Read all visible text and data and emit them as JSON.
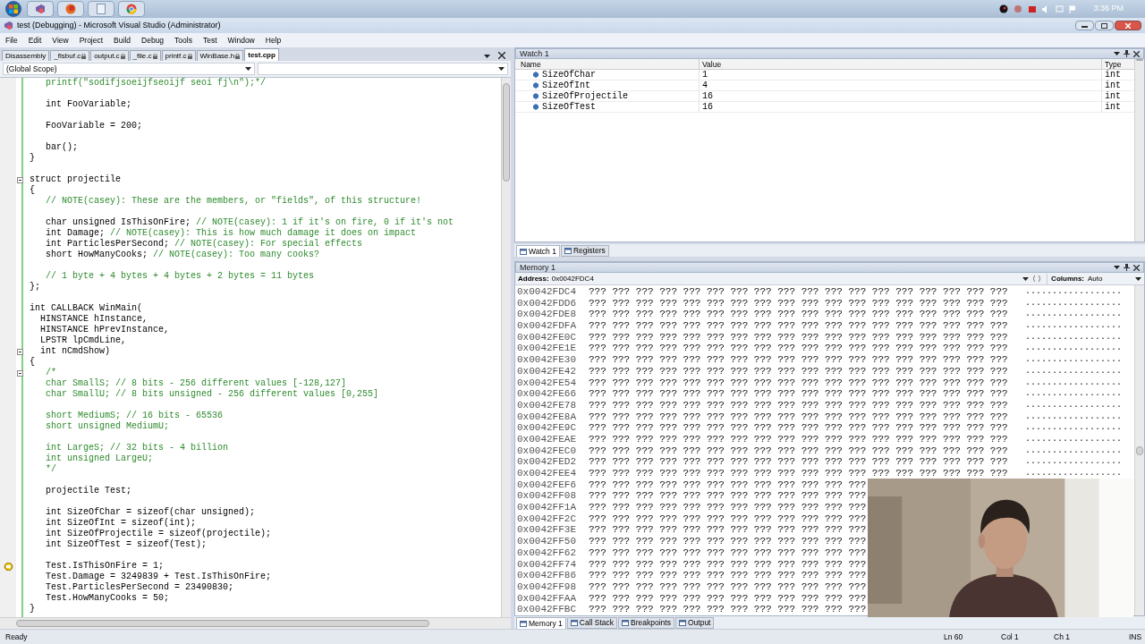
{
  "taskbar": {
    "clock": "3:36 PM"
  },
  "window": {
    "title": "test (Debugging) - Microsoft Visual Studio (Administrator)"
  },
  "menu": [
    "File",
    "Edit",
    "View",
    "Project",
    "Build",
    "Debug",
    "Tools",
    "Test",
    "Window",
    "Help"
  ],
  "editor": {
    "tabs": [
      {
        "label": "Disassembly",
        "selected": false
      },
      {
        "label": "_flsbuf.c",
        "selected": false
      },
      {
        "label": "output.c",
        "selected": false
      },
      {
        "label": "_file.c",
        "selected": false
      },
      {
        "label": "printf.c",
        "selected": false
      },
      {
        "label": "WinBase.h",
        "selected": false
      },
      {
        "label": "test.cpp",
        "selected": true
      }
    ],
    "scope": "(Global Scope)",
    "lines": [
      {
        "kind": "text",
        "comment": "   printf(\"sodifjsoeijfseoijf seoi fj\\n\");*/",
        "fold": false,
        "current": false
      },
      {
        "kind": "blank",
        "fold": false,
        "current": false
      },
      {
        "kind": "text",
        "code": "   int FooVariable;",
        "fold": false,
        "current": false
      },
      {
        "kind": "blank",
        "fold": false,
        "current": false
      },
      {
        "kind": "text",
        "code": "   FooVariable = 200;",
        "fold": false,
        "current": false
      },
      {
        "kind": "blank",
        "fold": false,
        "current": false
      },
      {
        "kind": "text",
        "code": "   bar();",
        "fold": false,
        "current": false
      },
      {
        "kind": "text",
        "code": "}",
        "fold": false,
        "current": false
      },
      {
        "kind": "blank",
        "fold": false,
        "current": false
      },
      {
        "kind": "text",
        "code": "struct projectile",
        "fold": true,
        "current": false
      },
      {
        "kind": "text",
        "code": "{",
        "fold": false,
        "current": false
      },
      {
        "kind": "text",
        "comment": "   // NOTE(casey): These are the members, or \"fields\", of this structure!",
        "fold": false,
        "current": false
      },
      {
        "kind": "blank",
        "fold": false,
        "current": false
      },
      {
        "kind": "text",
        "code": "   char unsigned IsThisOnFire; ",
        "comment": "// NOTE(casey): 1 if it's on fire, 0 if it's not",
        "fold": false,
        "current": false
      },
      {
        "kind": "text",
        "code": "   int Damage; ",
        "comment": "// NOTE(casey): This is how much damage it does on impact",
        "fold": false,
        "current": false
      },
      {
        "kind": "text",
        "code": "   int ParticlesPerSecond; ",
        "comment": "// NOTE(casey): For special effects",
        "fold": false,
        "current": false
      },
      {
        "kind": "text",
        "code": "   short HowManyCooks; ",
        "comment": "// NOTE(casey): Too many cooks?",
        "fold": false,
        "current": false
      },
      {
        "kind": "blank",
        "fold": false,
        "current": false
      },
      {
        "kind": "text",
        "comment": "   // 1 byte + 4 bytes + 4 bytes + 2 bytes = 11 bytes",
        "fold": false,
        "current": false
      },
      {
        "kind": "text",
        "code": "};",
        "fold": false,
        "current": false
      },
      {
        "kind": "blank",
        "fold": false,
        "current": false
      },
      {
        "kind": "text",
        "code": "int CALLBACK WinMain(",
        "fold": false,
        "current": false
      },
      {
        "kind": "text",
        "code": "  HINSTANCE hInstance,",
        "fold": false,
        "current": false
      },
      {
        "kind": "text",
        "code": "  HINSTANCE hPrevInstance,",
        "fold": false,
        "current": false
      },
      {
        "kind": "text",
        "code": "  LPSTR lpCmdLine,",
        "fold": false,
        "current": false
      },
      {
        "kind": "text",
        "code": "  int nCmdShow)",
        "fold": true,
        "current": false
      },
      {
        "kind": "text",
        "code": "{",
        "fold": false,
        "current": false
      },
      {
        "kind": "text",
        "comment": "   /*",
        "fold": true,
        "current": false
      },
      {
        "kind": "text",
        "comment": "   char SmallS; // 8 bits - 256 different values [-128,127]",
        "fold": false,
        "current": false
      },
      {
        "kind": "text",
        "comment": "   char SmallU; // 8 bits unsigned - 256 different values [0,255]",
        "fold": false,
        "current": false
      },
      {
        "kind": "blank",
        "fold": false,
        "current": false
      },
      {
        "kind": "text",
        "comment": "   short MediumS; // 16 bits - 65536",
        "fold": false,
        "current": false
      },
      {
        "kind": "text",
        "comment": "   short unsigned MediumU;",
        "fold": false,
        "current": false
      },
      {
        "kind": "blank",
        "fold": false,
        "current": false
      },
      {
        "kind": "text",
        "comment": "   int LargeS; // 32 bits - 4 billion",
        "fold": false,
        "current": false
      },
      {
        "kind": "text",
        "comment": "   int unsigned LargeU;",
        "fold": false,
        "current": false
      },
      {
        "kind": "text",
        "comment": "   */",
        "fold": false,
        "current": false
      },
      {
        "kind": "blank",
        "fold": false,
        "current": false
      },
      {
        "kind": "text",
        "code": "   projectile Test;",
        "fold": false,
        "current": false
      },
      {
        "kind": "blank",
        "fold": false,
        "current": false
      },
      {
        "kind": "text",
        "code": "   int SizeOfChar = sizeof(char unsigned);",
        "fold": false,
        "current": false
      },
      {
        "kind": "text",
        "code": "   int SizeOfInt = sizeof(int);",
        "fold": false,
        "current": false
      },
      {
        "kind": "text",
        "code": "   int SizeOfProjectile = sizeof(projectile);",
        "fold": false,
        "current": false
      },
      {
        "kind": "text",
        "code": "   int SizeOfTest = sizeof(Test);",
        "fold": false,
        "current": false
      },
      {
        "kind": "blank",
        "fold": false,
        "current": false
      },
      {
        "kind": "text",
        "code": "   Test.IsThisOnFire = 1;",
        "fold": false,
        "current": true
      },
      {
        "kind": "text",
        "code": "   Test.Damage = 3249839 + Test.IsThisOnFire;",
        "fold": false,
        "current": false
      },
      {
        "kind": "text",
        "code": "   Test.ParticlesPerSecond = 23490830;",
        "fold": false,
        "current": false
      },
      {
        "kind": "text",
        "code": "   Test.HowManyCooks = 50;",
        "fold": false,
        "current": false
      },
      {
        "kind": "text",
        "code": "}",
        "fold": false,
        "current": false
      }
    ]
  },
  "watch": {
    "title": "Watch 1",
    "columns": [
      "Name",
      "Value",
      "Type"
    ],
    "rows": [
      {
        "name": "SizeOfChar",
        "value": "1",
        "type": "int"
      },
      {
        "name": "SizeOfInt",
        "value": "4",
        "type": "int"
      },
      {
        "name": "SizeOfProjectile",
        "value": "16",
        "type": "int"
      },
      {
        "name": "SizeOfTest",
        "value": "16",
        "type": "int"
      }
    ]
  },
  "watch_tabs": [
    {
      "label": "Watch 1",
      "selected": true
    },
    {
      "label": "Registers",
      "selected": false
    }
  ],
  "memory": {
    "title": "Memory 1",
    "address_label": "Address:",
    "address": "0x0042FDC4",
    "columns_label": "Columns:",
    "columns_value": "Auto",
    "rows": [
      {
        "address": "0x0042FDC4",
        "bytes": "??? ??? ??? ??? ??? ??? ??? ??? ??? ??? ??? ??? ??? ??? ??? ??? ??? ???",
        "ascii": ".................."
      },
      {
        "address": "0x0042FDD6",
        "bytes": "??? ??? ??? ??? ??? ??? ??? ??? ??? ??? ??? ??? ??? ??? ??? ??? ??? ???",
        "ascii": ".................."
      },
      {
        "address": "0x0042FDE8",
        "bytes": "??? ??? ??? ??? ??? ??? ??? ??? ??? ??? ??? ??? ??? ??? ??? ??? ??? ???",
        "ascii": ".................."
      },
      {
        "address": "0x0042FDFA",
        "bytes": "??? ??? ??? ??? ??? ??? ??? ??? ??? ??? ??? ??? ??? ??? ??? ??? ??? ???",
        "ascii": ".................."
      },
      {
        "address": "0x0042FE0C",
        "bytes": "??? ??? ??? ??? ??? ??? ??? ??? ??? ??? ??? ??? ??? ??? ??? ??? ??? ???",
        "ascii": ".................."
      },
      {
        "address": "0x0042FE1E",
        "bytes": "??? ??? ??? ??? ??? ??? ??? ??? ??? ??? ??? ??? ??? ??? ??? ??? ??? ???",
        "ascii": ".................."
      },
      {
        "address": "0x0042FE30",
        "bytes": "??? ??? ??? ??? ??? ??? ??? ??? ??? ??? ??? ??? ??? ??? ??? ??? ??? ???",
        "ascii": ".................."
      },
      {
        "address": "0x0042FE42",
        "bytes": "??? ??? ??? ??? ??? ??? ??? ??? ??? ??? ??? ??? ??? ??? ??? ??? ??? ???",
        "ascii": ".................."
      },
      {
        "address": "0x0042FE54",
        "bytes": "??? ??? ??? ??? ??? ??? ??? ??? ??? ??? ??? ??? ??? ??? ??? ??? ??? ???",
        "ascii": ".................."
      },
      {
        "address": "0x0042FE66",
        "bytes": "??? ??? ??? ??? ??? ??? ??? ??? ??? ??? ??? ??? ??? ??? ??? ??? ??? ???",
        "ascii": ".................."
      },
      {
        "address": "0x0042FE78",
        "bytes": "??? ??? ??? ??? ??? ??? ??? ??? ??? ??? ??? ??? ??? ??? ??? ??? ??? ???",
        "ascii": ".................."
      },
      {
        "address": "0x0042FE8A",
        "bytes": "??? ??? ??? ??? ??? ??? ??? ??? ??? ??? ??? ??? ??? ??? ??? ??? ??? ???",
        "ascii": ".................."
      },
      {
        "address": "0x0042FE9C",
        "bytes": "??? ??? ??? ??? ??? ??? ??? ??? ??? ??? ??? ??? ??? ??? ??? ??? ??? ???",
        "ascii": ".................."
      },
      {
        "address": "0x0042FEAE",
        "bytes": "??? ??? ??? ??? ??? ??? ??? ??? ??? ??? ??? ??? ??? ??? ??? ??? ??? ???",
        "ascii": ".................."
      },
      {
        "address": "0x0042FEC0",
        "bytes": "??? ??? ??? ??? ??? ??? ??? ??? ??? ??? ??? ??? ??? ??? ??? ??? ??? ???",
        "ascii": ".................."
      },
      {
        "address": "0x0042FED2",
        "bytes": "??? ??? ??? ??? ??? ??? ??? ??? ??? ??? ??? ??? ??? ??? ??? ??? ??? ???",
        "ascii": ".................."
      },
      {
        "address": "0x0042FEE4",
        "bytes": "??? ??? ??? ??? ??? ??? ??? ??? ??? ??? ??? ??? ??? ??? ??? ??? ??? ???",
        "ascii": ".................."
      },
      {
        "address": "0x0042FEF6",
        "bytes": "??? ??? ??? ??? ??? ??? ??? ??? ??? ??? ??? ???"
      },
      {
        "address": "0x0042FF08",
        "bytes": "??? ??? ??? ??? ??? ??? ??? ??? ??? ??? ??? ???"
      },
      {
        "address": "0x0042FF1A",
        "bytes": "??? ??? ??? ??? ??? ??? ??? ??? ??? ??? ??? ???"
      },
      {
        "address": "0x0042FF2C",
        "bytes": "??? ??? ??? ??? ??? ??? ??? ??? ??? ??? ??? ???"
      },
      {
        "address": "0x0042FF3E",
        "bytes": "??? ??? ??? ??? ??? ??? ??? ??? ??? ??? ??? ???"
      },
      {
        "address": "0x0042FF50",
        "bytes": "??? ??? ??? ??? ??? ??? ??? ??? ??? ??? ??? ???"
      },
      {
        "address": "0x0042FF62",
        "bytes": "??? ??? ??? ??? ??? ??? ??? ??? ??? ??? ??? ???"
      },
      {
        "address": "0x0042FF74",
        "bytes": "??? ??? ??? ??? ??? ??? ??? ??? ??? ??? ??? ???"
      },
      {
        "address": "0x0042FF86",
        "bytes": "??? ??? ??? ??? ??? ??? ??? ??? ??? ??? ??? ???"
      },
      {
        "address": "0x0042FF98",
        "bytes": "??? ??? ??? ??? ??? ??? ??? ??? ??? ??? ??? ???"
      },
      {
        "address": "0x0042FFAA",
        "bytes": "??? ??? ??? ??? ??? ??? ??? ??? ??? ??? ??? ???"
      },
      {
        "address": "0x0042FFBC",
        "bytes": "??? ??? ??? ??? ??? ??? ??? ??? ??? ??? ??? ???"
      }
    ]
  },
  "memory_tabs": [
    {
      "label": "Memory 1",
      "selected": true
    },
    {
      "label": "Call Stack",
      "selected": false
    },
    {
      "label": "Breakpoints",
      "selected": false
    },
    {
      "label": "Output",
      "selected": false
    }
  ],
  "status": {
    "text": "Ready",
    "ln": "Ln 60",
    "col": "Col 1",
    "ch": "Ch 1",
    "mode": "INS"
  }
}
